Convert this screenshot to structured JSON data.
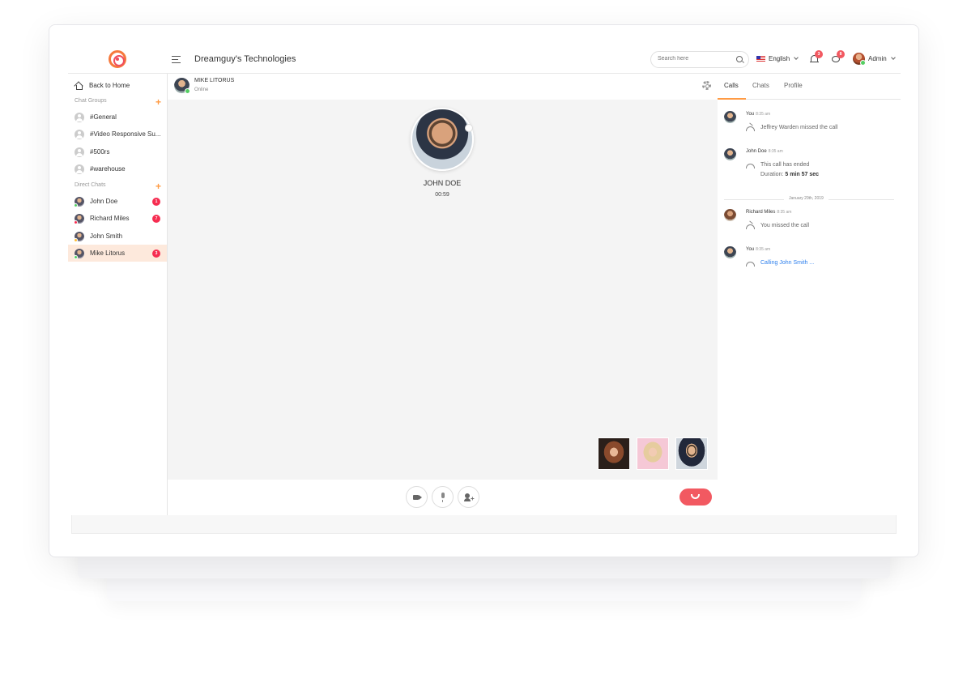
{
  "header": {
    "company": "Dreamguy's Technologies",
    "search_placeholder": "Search here",
    "language": "English",
    "notification_count": "3",
    "message_count": "8",
    "user": "Admin"
  },
  "sidebar": {
    "back_home": "Back to Home",
    "chat_groups_label": "Chat Groups",
    "groups": [
      "#General",
      "#Video Responsive Su...",
      "#500rs",
      "#warehouse"
    ],
    "direct_chats_label": "Direct Chats",
    "direct": [
      {
        "name": "John Doe",
        "badge": "1",
        "status": "online"
      },
      {
        "name": "Richard Miles",
        "badge": "7",
        "status": "offline"
      },
      {
        "name": "John Smith",
        "badge": "",
        "status": "away"
      },
      {
        "name": "Mike Litorus",
        "badge": "3",
        "status": "online",
        "active": true
      }
    ]
  },
  "chat_header": {
    "name": "MIKE LITORUS",
    "status": "Online"
  },
  "call": {
    "name": "JOHN DOE",
    "timer": "00:59"
  },
  "right_panel": {
    "tabs": [
      "Calls",
      "Chats",
      "Profile"
    ],
    "active_tab": "Calls",
    "entries": [
      {
        "name": "You",
        "time": "8:35 am",
        "text": "Jeffrey Warden missed the call"
      },
      {
        "name": "John Doe",
        "time": "8:35 am",
        "text": "This call has ended",
        "duration_label": "Duration:",
        "duration_value": "5 min 57 sec"
      },
      {
        "name": "Richard Miles",
        "time": "8:35 am",
        "text": "You missed the call"
      },
      {
        "name": "You",
        "time": "8:35 am",
        "text": "Calling John Smith ..."
      }
    ],
    "date_separator": "January 29th, 2019"
  },
  "colors": {
    "accent": "#ff9b44",
    "badge": "#f62d51",
    "end_call": "#f25961",
    "link": "#2f80ed",
    "active_row": "#fde9dc"
  },
  "icons": [
    "app-logo-icon",
    "menu-icon",
    "search-icon",
    "us-flag-icon",
    "bell-icon",
    "chat-icon",
    "home-icon",
    "plus-icon",
    "gear-icon",
    "video-icon",
    "mic-icon",
    "add-user-icon",
    "end-call-icon",
    "missed-call-icon",
    "call-ended-icon",
    "outgoing-call-icon"
  ]
}
